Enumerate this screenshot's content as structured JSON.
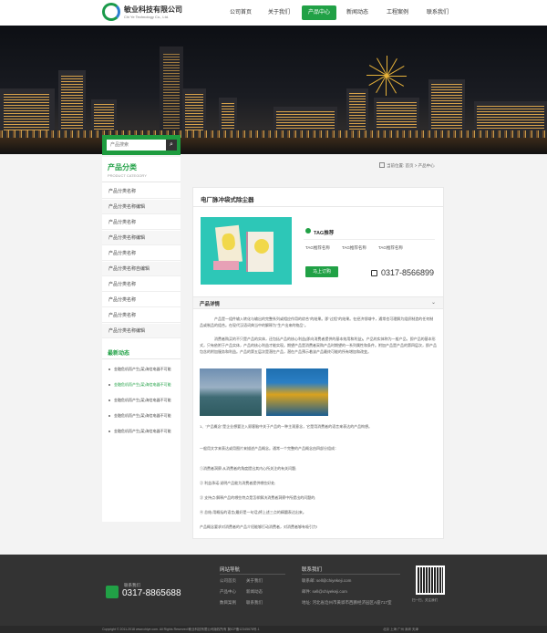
{
  "header": {
    "logo_name": "敏业科技有限公司",
    "logo_en": "Chi Ye Technology Co., Ltd.",
    "nav": [
      "公司首页",
      "关于我们",
      "产品中心",
      "新闻动态",
      "工程案例",
      "联系我们"
    ],
    "nav_active": "产品中心"
  },
  "search": {
    "placeholder": "产品搜索",
    "button": "⌕"
  },
  "sidebar": {
    "title": "产品分类",
    "subtitle": "PRODUCT CATEGORY",
    "items": [
      "产品分类名称",
      "产品分类名称编辑",
      "产品分类名称",
      "产品分类名称编辑",
      "产品分类名称",
      "产品分类名称自编辑",
      "产品分类名称",
      "产品分类名称",
      "产品分类名称",
      "产品分类名称编辑"
    ],
    "news_title": "最新动态",
    "news": [
      "金融危机而产生(某)海信电器不可能",
      "金融危机而产生(某)海信电器不可能",
      "金融危机而产生(某)海信电器不可能",
      "金融危机而产生(某)海信电器不可能",
      "金融危机而产生(某)海信电器不可能"
    ]
  },
  "breadcrumb": "当前位置: 首页 > 产品中心",
  "product": {
    "title": "电厂脉冲袋式除尘器",
    "tag_label": "TAG推荐",
    "tags": [
      "TAG推荐名称",
      "TAG推荐名称",
      "TAG推荐名称"
    ],
    "order_button": "马上订购",
    "phone": "0317-8566899",
    "detail_title": "产品详情",
    "detail_chevron": "⌄",
    "para1": "产品是一组件输入转化与输出的完整系列或相应作用的综合\"的结果。即\"过程\"的结果。在经济领域中，通常也可理解为组织制造的任何制品或制品的组合。在现代汉语词典当中的解释为\"生产出来的物品\"。",
    "para2": "消费者购买的不只是产品的实体，还包括产品的核心利益(即向消费者提供的基本效用和利益)。产品的实体称为一般产品，即产品的基本形式，只有依附于产品实体，产品的核心利益才能实现。期望产品是消费者采购产品时期望的一系列属性和条件。附加产品是产品的第四层次，即产品包含的附加服务和利益。产品的第五层次是潜在产品，潜在产品预示着该产品最终可能的所有增加和改变。",
    "text_lines": [
      "1、\"产品概念\"是企业想要注入顾客脑中关于产品的一种主观意念，它是用消费者的语言来表达的产品构想。",
      "一般用文字来表达或用图片来描述产品概念。通常一个完整的产品概念由四部分组成：",
      "①消费者洞察:从消费者的角度提出其内心所关注的有关问题;",
      "② 利益承诺:说明产品能为消费者提供哪些好处;",
      "③ 支持点:解释产品的哪些特点是怎样解决消费者洞察中所提出的问题的;",
      "④ 总结:用概括的语言(最好是一句话)将上述三点的精髓表达出来。",
      "产品概念要求对消费者的产品介绍能够打动消费者，对消费者够有吸引力!"
    ]
  },
  "footer": {
    "contact_label": "联系我们",
    "phone": "0317-8865688",
    "nav_title": "网站导航",
    "links": [
      "公司首页",
      "关于我们",
      "产品中心",
      "新闻动态",
      "数目案例",
      "联系我们"
    ],
    "contact_title": "联系我们",
    "contact_rows": [
      "联系邮: sell@chiyekeji.com",
      "邮件: sell@chiyekeji.com",
      "地址: 河北省沧州市黄骅市西鹏经济园区A座717室"
    ],
    "qr_caption": "扫一扫，关注我们",
    "copyright": "Copyright © 2011-2018 www.chiye.com. All Rights Reserved  敏业科技有限公司版权所有 冀ICP备12345678号-1",
    "cities": "北京 上海 广州 深圳 天津"
  }
}
